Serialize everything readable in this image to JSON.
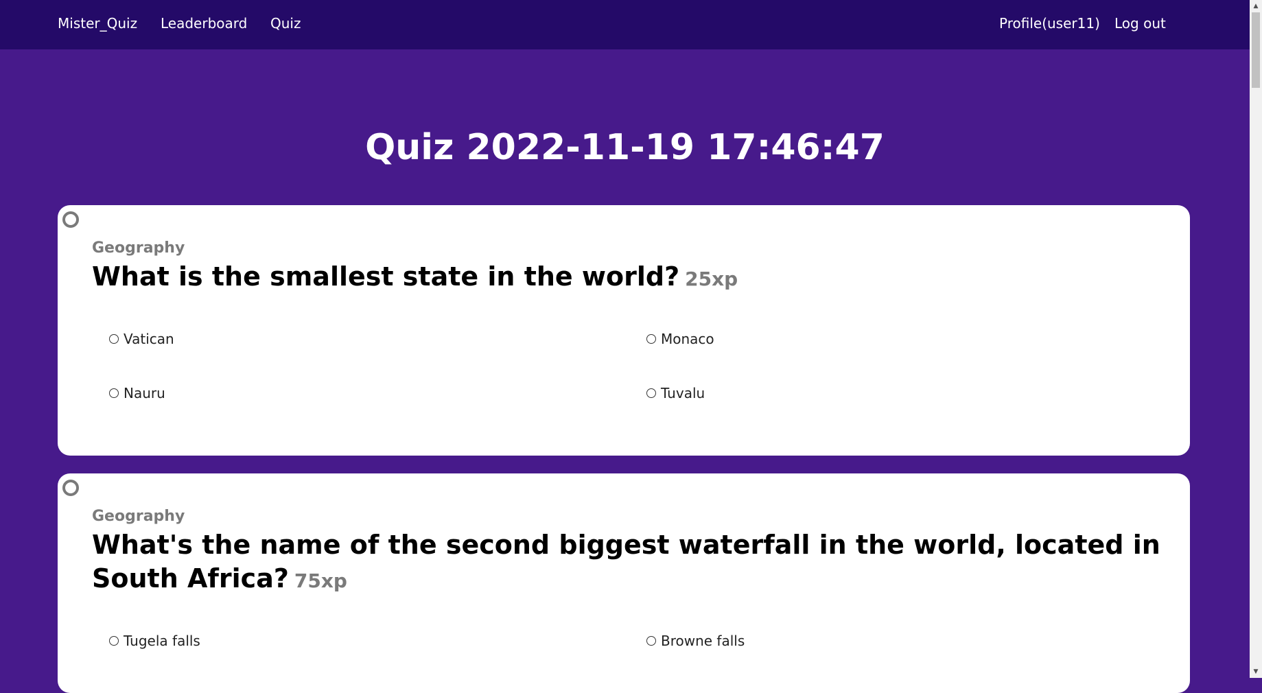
{
  "nav": {
    "brand": "Mister_Quiz",
    "leaderboard": "Leaderboard",
    "quiz": "Quiz",
    "profile": "Profile(user11)",
    "logout": "Log out"
  },
  "page_title": "Quiz 2022-11-19 17:46:47",
  "questions": [
    {
      "category": "Geography",
      "text": "What is the smallest state in the world?",
      "xp": "25xp",
      "options": [
        "Vatican",
        "Monaco",
        "Nauru",
        "Tuvalu"
      ]
    },
    {
      "category": "Geography",
      "text": "What's the name of the second biggest waterfall in the world, located in South Africa?",
      "xp": "75xp",
      "options": [
        "Tugela falls",
        "Browne falls"
      ]
    }
  ],
  "colors": {
    "navbar_bg": "#240a68",
    "page_bg": "#471a8b",
    "card_bg": "#ffffff",
    "muted_text": "#7a7a7a"
  },
  "icons": {
    "question_status": "circle-outline-icon",
    "scroll_up": "arrow-up-icon",
    "scroll_down": "arrow-down-icon"
  }
}
